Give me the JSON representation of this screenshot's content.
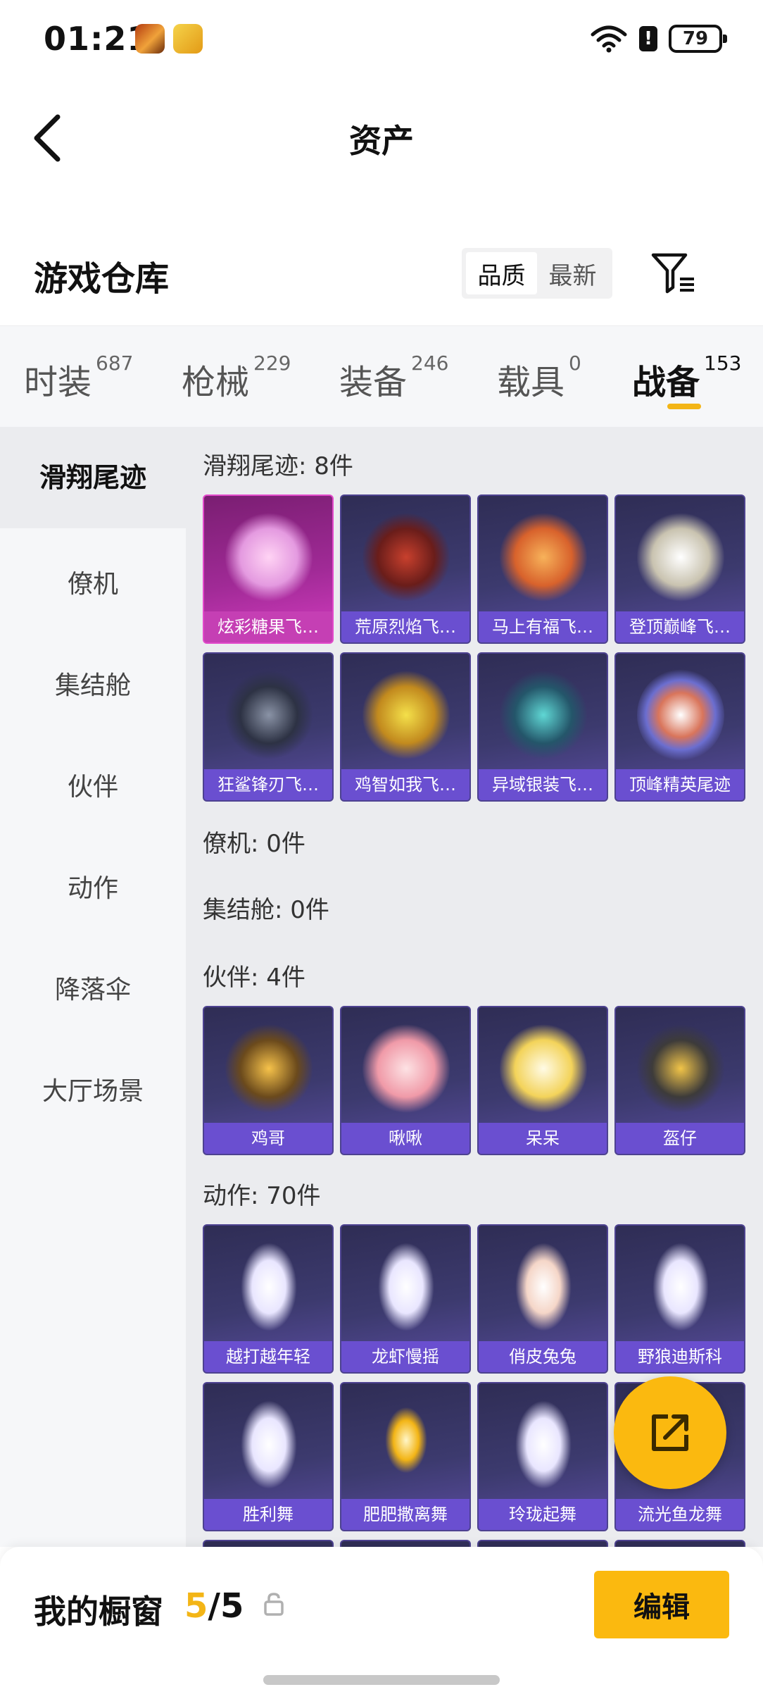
{
  "status_bar": {
    "time": "01:21",
    "battery": "79",
    "alert": "!"
  },
  "header": {
    "title": "资产"
  },
  "warehouse": {
    "title": "游戏仓库",
    "sort_options": [
      "品质",
      "最新"
    ],
    "active_sort": "品质"
  },
  "tabs": [
    {
      "label": "时装",
      "count": "687"
    },
    {
      "label": "枪械",
      "count": "229"
    },
    {
      "label": "装备",
      "count": "246"
    },
    {
      "label": "载具",
      "count": "0"
    },
    {
      "label": "战备",
      "count": "153"
    }
  ],
  "active_tab": "战备",
  "sidebar": {
    "items": [
      "滑翔尾迹",
      "僚机",
      "集结舱",
      "伙伴",
      "动作",
      "降落伞",
      "大厅场景"
    ],
    "active": "滑翔尾迹"
  },
  "sections": {
    "glide": {
      "title": "滑翔尾迹: 8件",
      "items": [
        "炫彩糖果飞…",
        "荒原烈焰飞…",
        "马上有福飞…",
        "登顶巅峰飞…",
        "狂鲨锋刃飞…",
        "鸡智如我飞…",
        "异域银装飞…",
        "顶峰精英尾迹"
      ]
    },
    "wingman": {
      "title": "僚机: 0件"
    },
    "pod": {
      "title": "集结舱: 0件"
    },
    "partner": {
      "title": "伙伴: 4件",
      "items": [
        "鸡哥",
        "啾啾",
        "呆呆",
        "盔仔"
      ]
    },
    "emote": {
      "title": "动作: 70件",
      "items": [
        "越打越年轻",
        "龙虾慢摇",
        "俏皮兔兔",
        "野狼迪斯科",
        "胜利舞",
        "肥肥撒离舞",
        "玲珑起舞",
        "流光鱼龙舞"
      ]
    }
  },
  "bottom_bar": {
    "label": "我的橱窗",
    "current": "5",
    "separator": "/",
    "total": "5",
    "edit_label": "编辑"
  },
  "colors": {
    "accent": "#fbb90f",
    "card_bg": "#3c3a6e",
    "card_label": "#6a4fd0",
    "highlight_card": "#c53fb4"
  }
}
